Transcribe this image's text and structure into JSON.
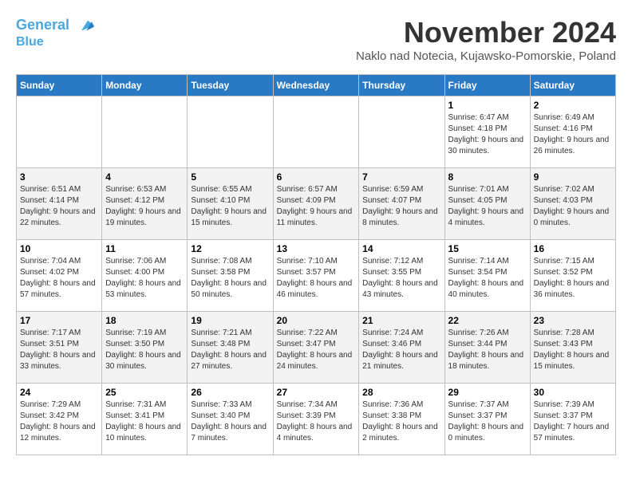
{
  "header": {
    "logo_line1": "General",
    "logo_line2": "Blue",
    "month_title": "November 2024",
    "location": "Naklo nad Notecia, Kujawsko-Pomorskie, Poland"
  },
  "weekdays": [
    "Sunday",
    "Monday",
    "Tuesday",
    "Wednesday",
    "Thursday",
    "Friday",
    "Saturday"
  ],
  "weeks": [
    [
      {
        "day": "",
        "info": ""
      },
      {
        "day": "",
        "info": ""
      },
      {
        "day": "",
        "info": ""
      },
      {
        "day": "",
        "info": ""
      },
      {
        "day": "",
        "info": ""
      },
      {
        "day": "1",
        "info": "Sunrise: 6:47 AM\nSunset: 4:18 PM\nDaylight: 9 hours and 30 minutes."
      },
      {
        "day": "2",
        "info": "Sunrise: 6:49 AM\nSunset: 4:16 PM\nDaylight: 9 hours and 26 minutes."
      }
    ],
    [
      {
        "day": "3",
        "info": "Sunrise: 6:51 AM\nSunset: 4:14 PM\nDaylight: 9 hours and 22 minutes."
      },
      {
        "day": "4",
        "info": "Sunrise: 6:53 AM\nSunset: 4:12 PM\nDaylight: 9 hours and 19 minutes."
      },
      {
        "day": "5",
        "info": "Sunrise: 6:55 AM\nSunset: 4:10 PM\nDaylight: 9 hours and 15 minutes."
      },
      {
        "day": "6",
        "info": "Sunrise: 6:57 AM\nSunset: 4:09 PM\nDaylight: 9 hours and 11 minutes."
      },
      {
        "day": "7",
        "info": "Sunrise: 6:59 AM\nSunset: 4:07 PM\nDaylight: 9 hours and 8 minutes."
      },
      {
        "day": "8",
        "info": "Sunrise: 7:01 AM\nSunset: 4:05 PM\nDaylight: 9 hours and 4 minutes."
      },
      {
        "day": "9",
        "info": "Sunrise: 7:02 AM\nSunset: 4:03 PM\nDaylight: 9 hours and 0 minutes."
      }
    ],
    [
      {
        "day": "10",
        "info": "Sunrise: 7:04 AM\nSunset: 4:02 PM\nDaylight: 8 hours and 57 minutes."
      },
      {
        "day": "11",
        "info": "Sunrise: 7:06 AM\nSunset: 4:00 PM\nDaylight: 8 hours and 53 minutes."
      },
      {
        "day": "12",
        "info": "Sunrise: 7:08 AM\nSunset: 3:58 PM\nDaylight: 8 hours and 50 minutes."
      },
      {
        "day": "13",
        "info": "Sunrise: 7:10 AM\nSunset: 3:57 PM\nDaylight: 8 hours and 46 minutes."
      },
      {
        "day": "14",
        "info": "Sunrise: 7:12 AM\nSunset: 3:55 PM\nDaylight: 8 hours and 43 minutes."
      },
      {
        "day": "15",
        "info": "Sunrise: 7:14 AM\nSunset: 3:54 PM\nDaylight: 8 hours and 40 minutes."
      },
      {
        "day": "16",
        "info": "Sunrise: 7:15 AM\nSunset: 3:52 PM\nDaylight: 8 hours and 36 minutes."
      }
    ],
    [
      {
        "day": "17",
        "info": "Sunrise: 7:17 AM\nSunset: 3:51 PM\nDaylight: 8 hours and 33 minutes."
      },
      {
        "day": "18",
        "info": "Sunrise: 7:19 AM\nSunset: 3:50 PM\nDaylight: 8 hours and 30 minutes."
      },
      {
        "day": "19",
        "info": "Sunrise: 7:21 AM\nSunset: 3:48 PM\nDaylight: 8 hours and 27 minutes."
      },
      {
        "day": "20",
        "info": "Sunrise: 7:22 AM\nSunset: 3:47 PM\nDaylight: 8 hours and 24 minutes."
      },
      {
        "day": "21",
        "info": "Sunrise: 7:24 AM\nSunset: 3:46 PM\nDaylight: 8 hours and 21 minutes."
      },
      {
        "day": "22",
        "info": "Sunrise: 7:26 AM\nSunset: 3:44 PM\nDaylight: 8 hours and 18 minutes."
      },
      {
        "day": "23",
        "info": "Sunrise: 7:28 AM\nSunset: 3:43 PM\nDaylight: 8 hours and 15 minutes."
      }
    ],
    [
      {
        "day": "24",
        "info": "Sunrise: 7:29 AM\nSunset: 3:42 PM\nDaylight: 8 hours and 12 minutes."
      },
      {
        "day": "25",
        "info": "Sunrise: 7:31 AM\nSunset: 3:41 PM\nDaylight: 8 hours and 10 minutes."
      },
      {
        "day": "26",
        "info": "Sunrise: 7:33 AM\nSunset: 3:40 PM\nDaylight: 8 hours and 7 minutes."
      },
      {
        "day": "27",
        "info": "Sunrise: 7:34 AM\nSunset: 3:39 PM\nDaylight: 8 hours and 4 minutes."
      },
      {
        "day": "28",
        "info": "Sunrise: 7:36 AM\nSunset: 3:38 PM\nDaylight: 8 hours and 2 minutes."
      },
      {
        "day": "29",
        "info": "Sunrise: 7:37 AM\nSunset: 3:37 PM\nDaylight: 8 hours and 0 minutes."
      },
      {
        "day": "30",
        "info": "Sunrise: 7:39 AM\nSunset: 3:37 PM\nDaylight: 7 hours and 57 minutes."
      }
    ]
  ]
}
